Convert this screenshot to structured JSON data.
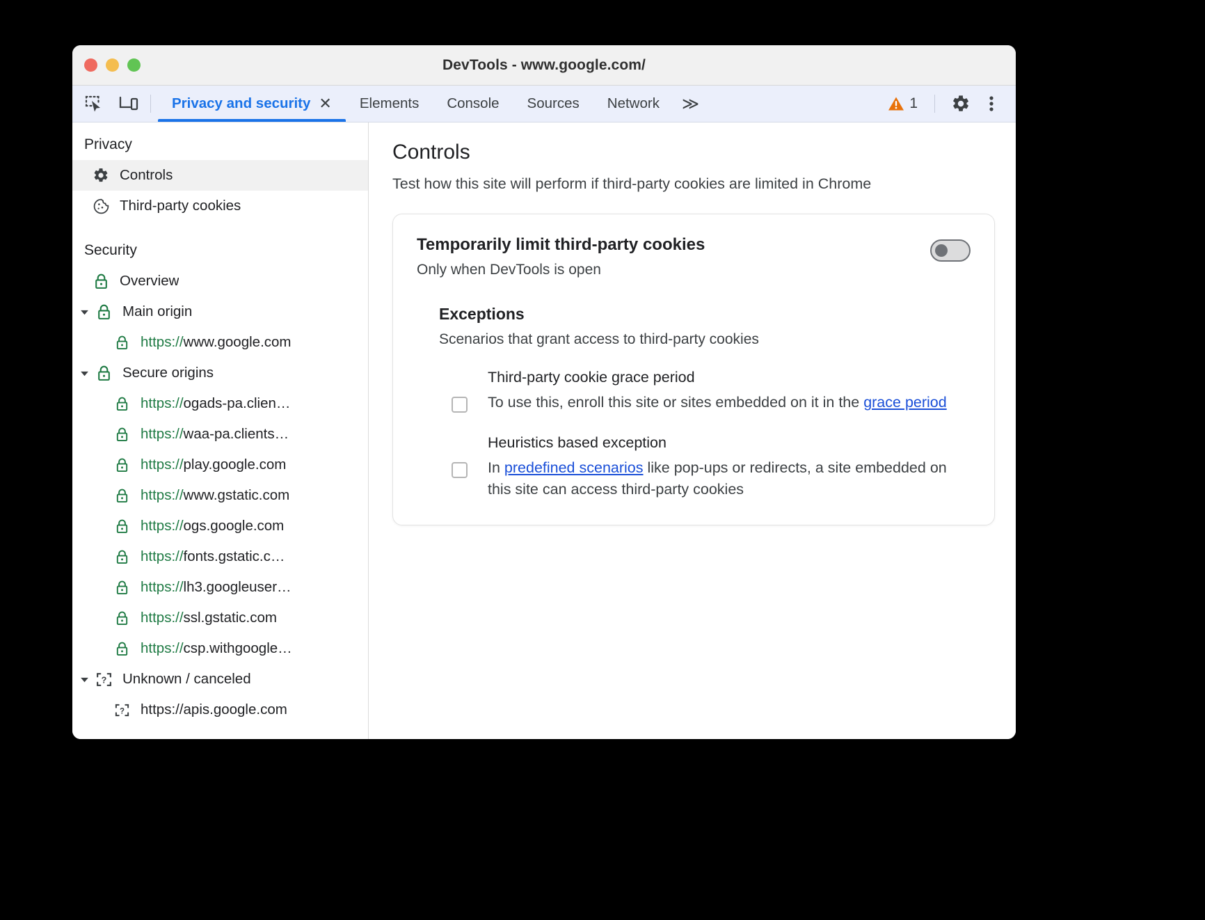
{
  "window": {
    "title": "DevTools - www.google.com/",
    "traffic_lights": [
      "close",
      "minimize",
      "zoom"
    ]
  },
  "toolbar": {
    "inspect_icon": "inspect-element-icon",
    "device_icon": "device-toolbar-icon",
    "tabs": [
      {
        "label": "Privacy and security",
        "active": true,
        "closable": true,
        "close_label": "✕"
      },
      {
        "label": "Elements",
        "active": false
      },
      {
        "label": "Console",
        "active": false
      },
      {
        "label": "Sources",
        "active": false
      },
      {
        "label": "Network",
        "active": false
      }
    ],
    "more_tabs_label": "≫",
    "warning_count": "1",
    "settings_icon": "gear-icon",
    "more_options_icon": "three-dot-menu-icon"
  },
  "sidebar": {
    "groups": [
      {
        "title": "Privacy",
        "items": [
          {
            "label": "Controls",
            "icon": "gear-icon",
            "selected": true,
            "level": 0
          },
          {
            "label": "Third-party cookies",
            "icon": "cookie-icon",
            "selected": false,
            "level": 0
          }
        ]
      },
      {
        "title": "Security",
        "items": [
          {
            "label": "Overview",
            "icon": "lock-icon",
            "selected": false,
            "level": 0
          },
          {
            "label": "Main origin",
            "icon": "lock-icon",
            "selected": false,
            "level": 0,
            "twisty": "expanded"
          },
          {
            "scheme": "https://",
            "host": "www.google.com",
            "icon": "lock-icon",
            "selected": false,
            "level": 1
          },
          {
            "label": "Secure origins",
            "icon": "lock-icon",
            "selected": false,
            "level": 0,
            "twisty": "expanded"
          },
          {
            "scheme": "https://",
            "host": "ogads-pa.clien…",
            "icon": "lock-icon",
            "selected": false,
            "level": 1
          },
          {
            "scheme": "https://",
            "host": "waa-pa.clients…",
            "icon": "lock-icon",
            "selected": false,
            "level": 1
          },
          {
            "scheme": "https://",
            "host": "play.google.com",
            "icon": "lock-icon",
            "selected": false,
            "level": 1
          },
          {
            "scheme": "https://",
            "host": "www.gstatic.com",
            "icon": "lock-icon",
            "selected": false,
            "level": 1
          },
          {
            "scheme": "https://",
            "host": "ogs.google.com",
            "icon": "lock-icon",
            "selected": false,
            "level": 1
          },
          {
            "scheme": "https://",
            "host": "fonts.gstatic.c…",
            "icon": "lock-icon",
            "selected": false,
            "level": 1
          },
          {
            "scheme": "https://",
            "host": "lh3.googleuser…",
            "icon": "lock-icon",
            "selected": false,
            "level": 1
          },
          {
            "scheme": "https://",
            "host": "ssl.gstatic.com",
            "icon": "lock-icon",
            "selected": false,
            "level": 1
          },
          {
            "scheme": "https://",
            "host": "csp.withgoogle…",
            "icon": "lock-icon",
            "selected": false,
            "level": 1
          },
          {
            "label": "Unknown / canceled",
            "icon": "unknown-icon",
            "selected": false,
            "level": 0,
            "twisty": "expanded"
          },
          {
            "plain": "https://apis.google.com",
            "icon": "unknown-icon",
            "selected": false,
            "level": 1
          }
        ]
      }
    ]
  },
  "main": {
    "title": "Controls",
    "subtitle": "Test how this site will perform if third-party cookies are limited in Chrome",
    "card": {
      "title": "Temporarily limit third-party cookies",
      "subtitle": "Only when DevTools is open",
      "toggle": {
        "state": "off",
        "name": "limit-third-party-cookies-toggle"
      },
      "exceptions": {
        "title": "Exceptions",
        "subtitle": "Scenarios that grant access to third-party cookies",
        "items": [
          {
            "name": "Third-party cookie grace period",
            "checked": false,
            "desc_before": "To use this, enroll this site or sites embedded on it in the ",
            "link": "grace period",
            "desc_after": ""
          },
          {
            "name": "Heuristics based exception",
            "checked": false,
            "desc_before": "In ",
            "link": "predefined scenarios",
            "desc_after": " like pop-ups or redirects, a site embedded on this site can access third-party cookies"
          }
        ]
      }
    }
  },
  "colors": {
    "accent": "#1a73e8",
    "tabbar_bg": "#ebeffb",
    "link": "#1a4fd8",
    "secure_green": "#1e7a43",
    "warning_orange": "#e8710a"
  }
}
